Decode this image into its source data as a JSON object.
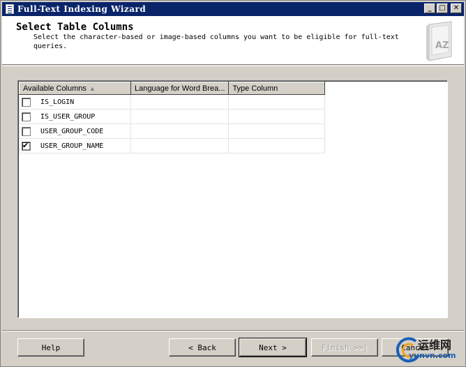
{
  "window": {
    "title": "Full-Text Indexing Wizard",
    "controls": {
      "minimize": "_",
      "maximize": "□",
      "close": "✕"
    }
  },
  "header": {
    "title": "Select Table Columns",
    "description": "Select the character-based or image-based columns you want to be eligible for full-text queries.",
    "graphic_label": "AZ"
  },
  "grid": {
    "columns": [
      "Available Columns",
      "Language for Word Brea...",
      "Type Column"
    ],
    "sort_indicator": "▲",
    "rows": [
      {
        "name": "IS_LOGIN",
        "language": "",
        "type": "",
        "checked": false
      },
      {
        "name": "IS_USER_GROUP",
        "language": "",
        "type": "",
        "checked": false
      },
      {
        "name": "USER_GROUP_CODE",
        "language": "",
        "type": "",
        "checked": false
      },
      {
        "name": "USER_GROUP_NAME",
        "language": "",
        "type": "",
        "checked": true
      }
    ]
  },
  "buttons": {
    "help": "Help",
    "back": "< Back",
    "next": "Next >",
    "finish": "Finish >>|",
    "cancel": "Cancel"
  },
  "watermark": {
    "cn": "运维网",
    "en": "yunvn.com"
  },
  "colors": {
    "titlebar": "#0a246a",
    "face": "#d4d0c8",
    "watermark_blue": "#1a5fb4"
  }
}
